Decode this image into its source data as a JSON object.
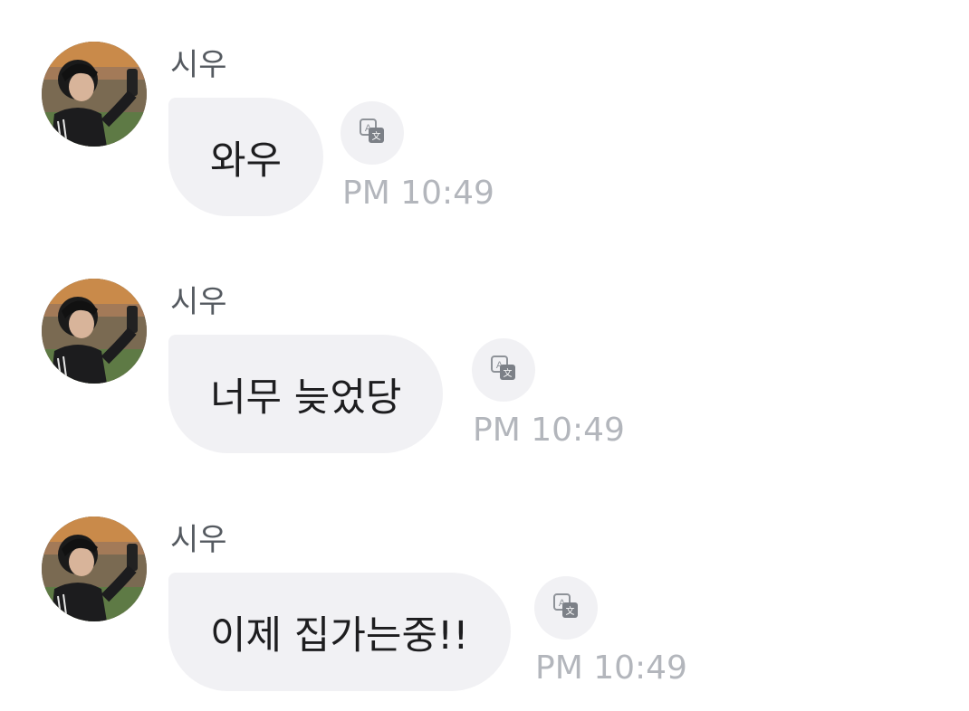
{
  "messages": [
    {
      "sender": "시우",
      "text": "와우",
      "time": "PM 10:49"
    },
    {
      "sender": "시우",
      "text": "너무 늦었당",
      "time": "PM 10:49"
    },
    {
      "sender": "시우",
      "text": "이제 집가는중!!",
      "time": "PM 10:49"
    }
  ],
  "icons": {
    "avatar": "profile-photo",
    "translate": "translate-icon"
  },
  "colors": {
    "bubble": "#f1f1f4",
    "timestamp": "#b3b6bc",
    "sender": "#555a60"
  }
}
